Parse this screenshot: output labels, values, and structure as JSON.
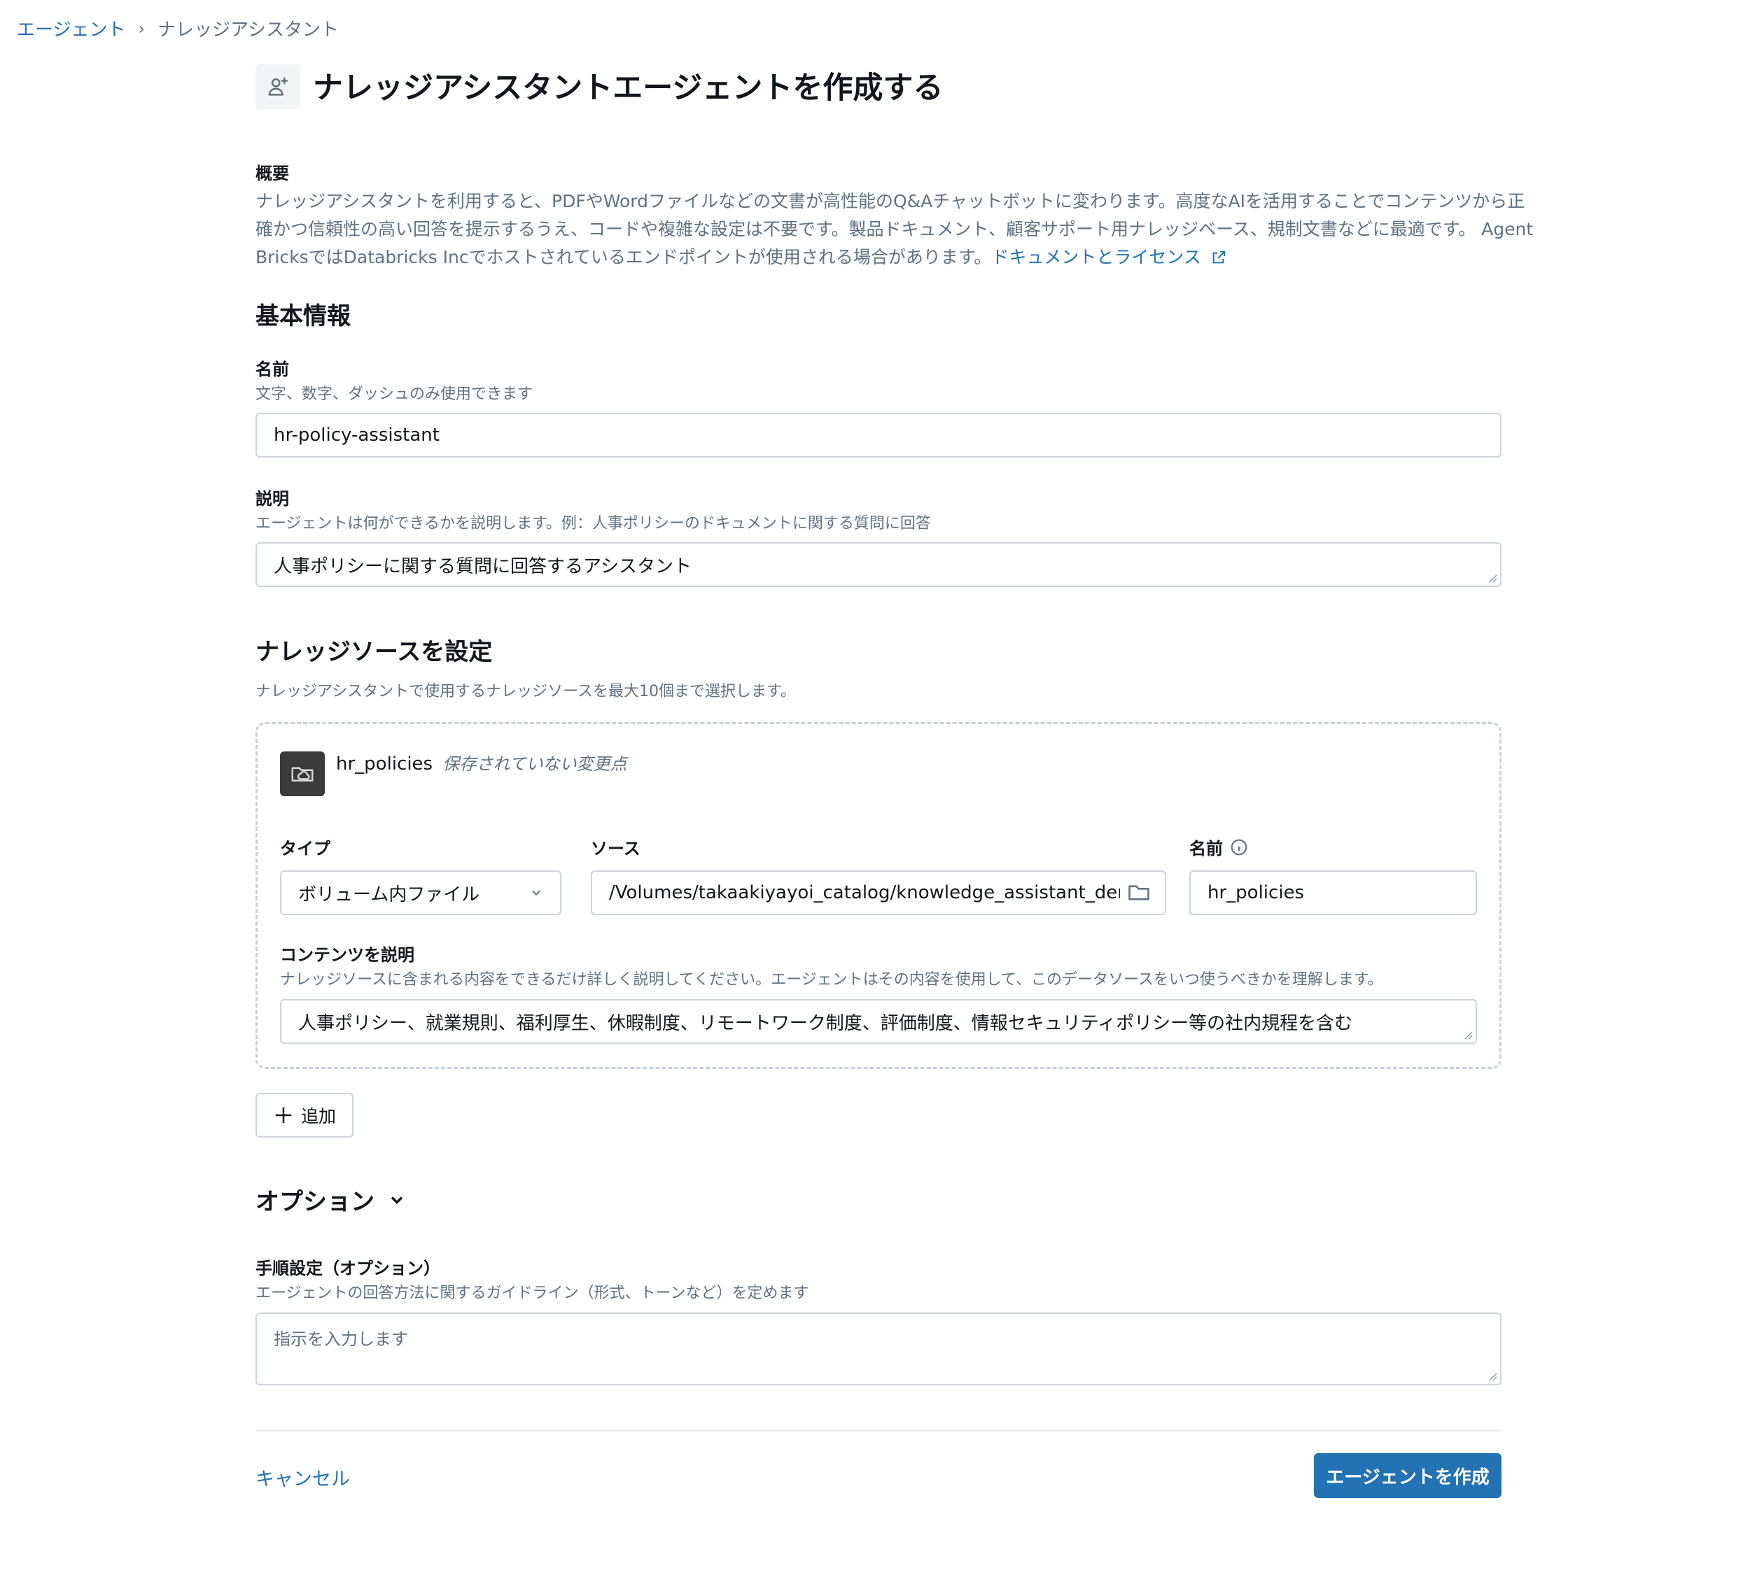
{
  "breadcrumb": {
    "root": "エージェント",
    "separator": "›",
    "current": "ナレッジアシスタント"
  },
  "header": {
    "title": "ナレッジアシスタントエージェントを作成する",
    "icon": "user-plus-icon"
  },
  "overview": {
    "label": "概要",
    "line1": "ナレッジアシスタントを利用すると、PDFやWordファイルなどの文書が高性能のQ&Aチャットボットに変わります。高度なAIを活用することでコンテンツから正",
    "line2": "確かつ信頼性の高い回答を提示するうえ、コードや複雑な設定は不要です。製品ドキュメント、顧客サポート用ナレッジベース、規制文書などに最適です。 Agent",
    "line3": "BricksではDatabricks Incでホストされているエンドポイントが使用される場合があります。",
    "link_text": "ドキュメントとライセンス",
    "link_icon": "external-link-icon"
  },
  "basic_info": {
    "heading": "基本情報",
    "name": {
      "label": "名前",
      "hint": "文字、数字、ダッシュのみ使用できます",
      "value": "hr-policy-assistant"
    },
    "description": {
      "label": "説明",
      "hint": "エージェントは何ができるかを説明します。例：人事ポリシーのドキュメントに関する質問に回答",
      "value": "人事ポリシーに関する質問に回答するアシスタント"
    }
  },
  "knowledge": {
    "heading": "ナレッジソースを設定",
    "hint": "ナレッジアシスタントで使用するナレッジソースを最大10個まで選択します。",
    "source": {
      "name": "hr_policies",
      "status": "保存されていない変更点",
      "type_label": "タイプ",
      "type_value": "ボリューム内ファイル",
      "source_label": "ソース",
      "source_value": "/Volumes/takaakiyayoi_catalog/knowledge_assistant_demo/",
      "name_label": "名前",
      "name_value": "hr_policies",
      "content_label": "コンテンツを説明",
      "content_hint": "ナレッジソースに含まれる内容をできるだけ詳しく説明してください。エージェントはその内容を使用して、このデータソースをいつ使うべきかを理解します。",
      "content_value": "人事ポリシー、就業規則、福利厚生、休暇制度、リモートワーク制度、評価制度、情報セキュリティポリシー等の社内規程を含む"
    },
    "add_label": "追加"
  },
  "options": {
    "heading": "オプション",
    "instructions_label": "手順設定（オプション）",
    "instructions_hint": "エージェントの回答方法に関するガイドライン（形式、トーンなど）を定めます",
    "instructions_placeholder": "指示を入力します"
  },
  "footer": {
    "cancel_label": "キャンセル",
    "create_label": "エージェントを作成"
  },
  "colors": {
    "accent": "#2272b4",
    "text": "#11171c",
    "muted": "#5f7281",
    "border": "#cbd5dc"
  }
}
